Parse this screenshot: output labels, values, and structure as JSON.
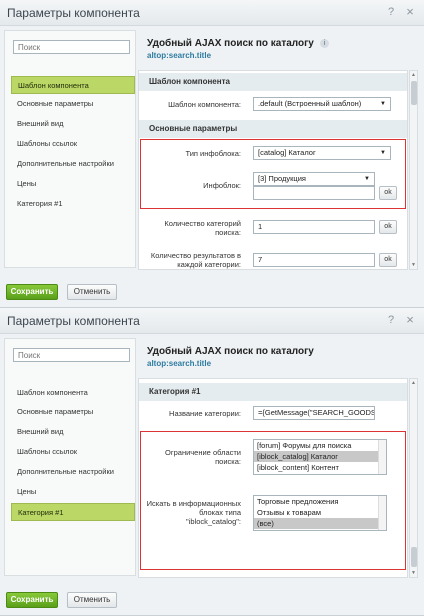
{
  "panel1": {
    "title": "Параметры компонента",
    "search_placeholder": "Поиск",
    "nav": [
      "Шаблон компонента",
      "Основные параметры",
      "Внешний вид",
      "Шаблоны ссылок",
      "Дополнительные настройки",
      "Цены",
      "Категория #1"
    ],
    "active_index": 0,
    "heading": "Удобный AJAX поиск по каталогу",
    "subheading": "altop:search.title",
    "sec_template": "Шаблон компонента",
    "template_label": "Шаблон компонента:",
    "template_value": ".default (Встроенный шаблон)",
    "sec_main": "Основные параметры",
    "iblock_type_label": "Тип инфоблока:",
    "iblock_type_value": "[catalog] Каталог",
    "iblock_label": "Инфоблок:",
    "iblock_value": "[3] Продукция",
    "ok": "ok",
    "cat_count_label": "Количество категорий поиска:",
    "cat_count_value": "1",
    "res_count_label": "Количество результатов в каждой категории:",
    "res_count_value": "7"
  },
  "panel2": {
    "title": "Параметры компонента",
    "search_placeholder": "Поиск",
    "nav": [
      "Шаблон компонента",
      "Основные параметры",
      "Внешний вид",
      "Шаблоны ссылок",
      "Дополнительные настройки",
      "Цены",
      "Категория #1"
    ],
    "active_index": 6,
    "heading": "Удобный AJAX поиск по каталогу",
    "subheading": "altop:search.title",
    "sec_category": "Категория #1",
    "cat_name_label": "Название категории:",
    "cat_name_value": "={GetMessage(\"SEARCH_GOODS\")}",
    "limit_label": "Ограничение области поиска:",
    "limit_options": [
      "[forum] Форумы для поиска",
      "[iblock_catalog] Каталог",
      "[iblock_content] Контент"
    ],
    "limit_selected": 1,
    "search_in_label": "Искать в информационных блоках типа \"iblock_catalog\":",
    "search_in_options": [
      "Торговые предложения",
      "Отзывы к товарам",
      "(все)"
    ],
    "search_in_selected": 2
  },
  "buttons": {
    "save": "Сохранить",
    "cancel": "Отменить"
  },
  "icons": {
    "help": "?",
    "close": "×"
  },
  "colors": {
    "active_nav": "#bbd765",
    "save_button": "#6aaa23",
    "highlight": "#dd3333",
    "link": "#2e7ba1"
  }
}
